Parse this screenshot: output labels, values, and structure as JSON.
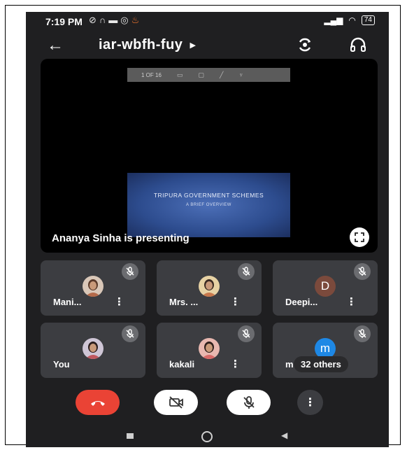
{
  "status_bar": {
    "time": "7:19 PM",
    "notifications": [
      "gallery-icon",
      "headphones-icon",
      "message-icon",
      "whatsapp-icon",
      "tinder-icon"
    ],
    "battery": "74"
  },
  "header": {
    "meeting_code": "iar-wbfh-fuy",
    "back_icon": "arrow-left-icon",
    "switch_camera_icon": "switch-camera-icon",
    "audio_icon": "headphones-icon"
  },
  "presentation": {
    "toolbar_page": "1 OF 16",
    "slide_title": "TRIPURA GOVERNMENT SCHEMES",
    "slide_subtitle": "A BRIEF OVERVIEW",
    "presenting_label": "Ananya Sinha is presenting"
  },
  "participants": [
    {
      "name": "Mani...",
      "avatar": "photo",
      "muted": true,
      "has_menu": true
    },
    {
      "name": "Mrs. ...",
      "avatar": "photo",
      "muted": true,
      "has_menu": true
    },
    {
      "name": "Deepi...",
      "avatar": "D",
      "avatar_color": "#7b4a3c",
      "muted": true,
      "has_menu": true
    },
    {
      "name": "You",
      "avatar": "photo",
      "muted": true,
      "has_menu": false
    },
    {
      "name": "kakali",
      "avatar": "photo",
      "muted": true,
      "has_menu": true
    },
    {
      "name": "m",
      "avatar": "m",
      "avatar_color": "#1e88e5",
      "muted": true,
      "has_menu": false,
      "others_label": "32 others"
    }
  ],
  "controls": [
    "end-call",
    "camera-off",
    "mic-off",
    "more-options"
  ],
  "colors": {
    "end_call": "#ea4335",
    "tile_bg": "#3c3d41",
    "background": "#1f1f21"
  }
}
